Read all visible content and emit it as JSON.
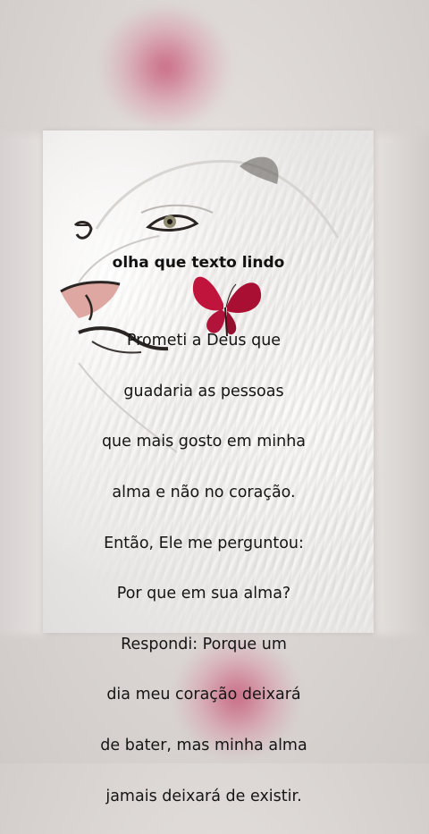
{
  "title": "olha que texto lindo",
  "poem_lines": [
    "Prometi a Deus que",
    "guadaria as pessoas",
    "que mais gosto em minha",
    "alma e não no coração.",
    "Então, Ele me perguntou:",
    "Por que em sua alma?",
    "Respondi: Porque um",
    "dia meu coração deixará",
    "de bater, mas minha alma",
    "jamais deixará de existir."
  ],
  "colors": {
    "butterfly": "#c0143c",
    "blur_accent": "#c44669",
    "text": "#151515"
  },
  "icons": [
    "butterfly-icon",
    "butterfly-icon",
    "lion-illustration"
  ]
}
